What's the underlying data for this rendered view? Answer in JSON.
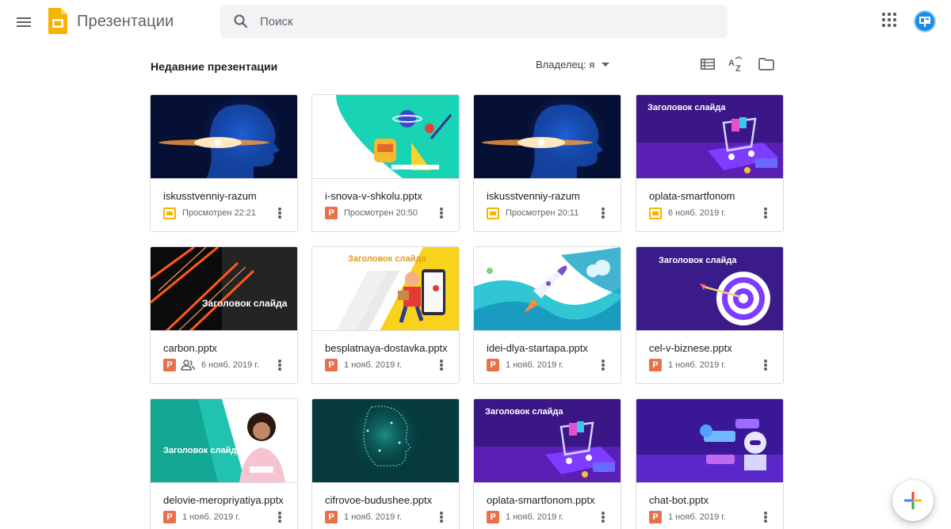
{
  "app": {
    "title": "Презентации",
    "search_placeholder": "Поиск",
    "brand_color": "#f4b400"
  },
  "toolbar": {
    "section_title": "Недавние презентации",
    "owner_filter": "Владелец: я",
    "icons": [
      "list-view-icon",
      "sort-az-icon",
      "folder-icon"
    ]
  },
  "files": [
    {
      "name": "iskusstvenniy-razum",
      "type": "slides",
      "meta": "Просмотрен 22:21",
      "shared": false,
      "thumb": "ai-head-blue"
    },
    {
      "name": "i-snova-v-shkolu.pptx",
      "type": "pptx",
      "meta": "Просмотрен 20:50",
      "shared": false,
      "thumb": "school-teal"
    },
    {
      "name": "iskusstvenniy-razum",
      "type": "slides",
      "meta": "Просмотрен 20:11",
      "shared": false,
      "thumb": "ai-head-blue"
    },
    {
      "name": "oplata-smartfonom",
      "type": "slides",
      "meta": "6 нояб. 2019 г.",
      "shared": false,
      "thumb": "shopping-purple",
      "thumb_title": "Заголовок слайда"
    },
    {
      "name": "carbon.pptx",
      "type": "pptx",
      "meta": "6 нояб. 2019 г.",
      "shared": true,
      "thumb": "carbon-dark",
      "thumb_title": "Заголовок слайда"
    },
    {
      "name": "besplatnaya-dostavka.pptx",
      "type": "pptx",
      "meta": "1 нояб. 2019 г.",
      "shared": false,
      "thumb": "delivery-yellow",
      "thumb_title": "Заголовок слайда"
    },
    {
      "name": "idei-dlya-startapa.pptx",
      "type": "pptx",
      "meta": "1 нояб. 2019 г.",
      "shared": false,
      "thumb": "rocket-teal"
    },
    {
      "name": "cel-v-biznese.pptx",
      "type": "pptx",
      "meta": "1 нояб. 2019 г.",
      "shared": false,
      "thumb": "target-purple",
      "thumb_title": "Заголовок слайда"
    },
    {
      "name": "delovie-meropriyatiya.pptx",
      "type": "pptx",
      "meta": "1 нояб. 2019 г.",
      "shared": false,
      "thumb": "woman-teal",
      "thumb_title": "Заголовок слайда"
    },
    {
      "name": "cifrovoe-budushee.pptx",
      "type": "pptx",
      "meta": "1 нояб. 2019 г.",
      "shared": false,
      "thumb": "digital-face"
    },
    {
      "name": "oplata-smartfonom.pptx",
      "type": "pptx",
      "meta": "1 нояб. 2019 г.",
      "shared": false,
      "thumb": "shopping-purple",
      "thumb_title": "Заголовок слайда"
    },
    {
      "name": "chat-bot.pptx",
      "type": "pptx",
      "meta": "1 нояб. 2019 г.",
      "shared": false,
      "thumb": "chatbot-purple"
    }
  ],
  "ppt_badge": "P",
  "fab_label": "+"
}
